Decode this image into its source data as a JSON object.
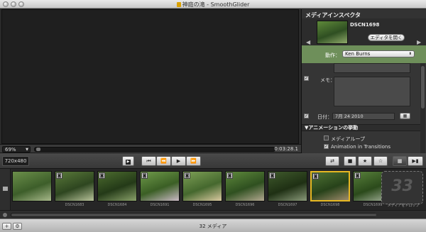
{
  "window": {
    "title": "神庭の滝 - SmoothGlider"
  },
  "scrub": {
    "zoom": "69%",
    "timecode": "0:03:28.1"
  },
  "inspector": {
    "title": "メディアインスペクタ",
    "clip_name": "DSCN1698",
    "open_editor": "エディタを開く",
    "motion_label": "動作：",
    "motion_value": "Ken Burns",
    "memo_label": "メモ：",
    "date_label": "日付：",
    "date_value": "7月 24 2010",
    "section": "▼アニメーションの挙動",
    "options": [
      {
        "label": "メディアループ",
        "checked": false
      },
      {
        "label": "Animation in Transitions",
        "checked": true
      }
    ]
  },
  "toolbar": {
    "resolution": "720x480"
  },
  "filmstrip": {
    "clips": [
      {
        "name": "",
        "colors": [
          "#6b8f4a",
          "#3d5e2a",
          "#a7b88a"
        ]
      },
      {
        "name": "DSCN1683",
        "colors": [
          "#5a7a3a",
          "#2e4620",
          "#b7c29a"
        ]
      },
      {
        "name": "DSCN1684",
        "colors": [
          "#4d6d2f",
          "#243a18",
          "#8aa16a"
        ]
      },
      {
        "name": "DSCN1691",
        "colors": [
          "#6f9a4a",
          "#3b5f25",
          "#c9b9c4"
        ]
      },
      {
        "name": "DSCN1695",
        "colors": [
          "#7ea056",
          "#45682e",
          "#d9c9a0"
        ]
      },
      {
        "name": "DSCN1696",
        "colors": [
          "#5f8a3c",
          "#2f5020",
          "#b2a890"
        ]
      },
      {
        "name": "DSCN1697",
        "colors": [
          "#3f5a2c",
          "#1f3014",
          "#8a9a7a"
        ]
      },
      {
        "name": "DSCN1698",
        "colors": [
          "#4f7334",
          "#27421a",
          "#9c8a6a"
        ]
      },
      {
        "name": "DSCN1699",
        "colors": [
          "#58803b",
          "#2b4a1b",
          "#a9b6a0"
        ]
      }
    ],
    "drop_number": "33",
    "drop_label": "メディアをドロップ"
  },
  "status": {
    "text": "32 メディア"
  }
}
